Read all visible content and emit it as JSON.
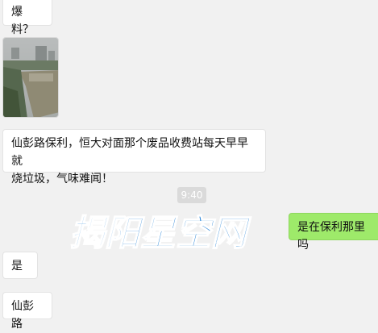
{
  "messages": {
    "m1": "爆料？",
    "m2": "仙彭路保利，恒大对面那个废品收费站每天早早就",
    "m2b": "烧垃圾，气味难闻！",
    "m3": "是在保利那里吗",
    "m4": "是",
    "m5": "仙彭路"
  },
  "time_label": "9:40",
  "watermark_text": "揭阳星空网",
  "photo_description": "outdoor-photo",
  "colors": {
    "self_bubble": "#9eea6a",
    "other_bubble": "#ffffff",
    "background": "#f1f1f1",
    "watermark": "#1e7fd6"
  }
}
